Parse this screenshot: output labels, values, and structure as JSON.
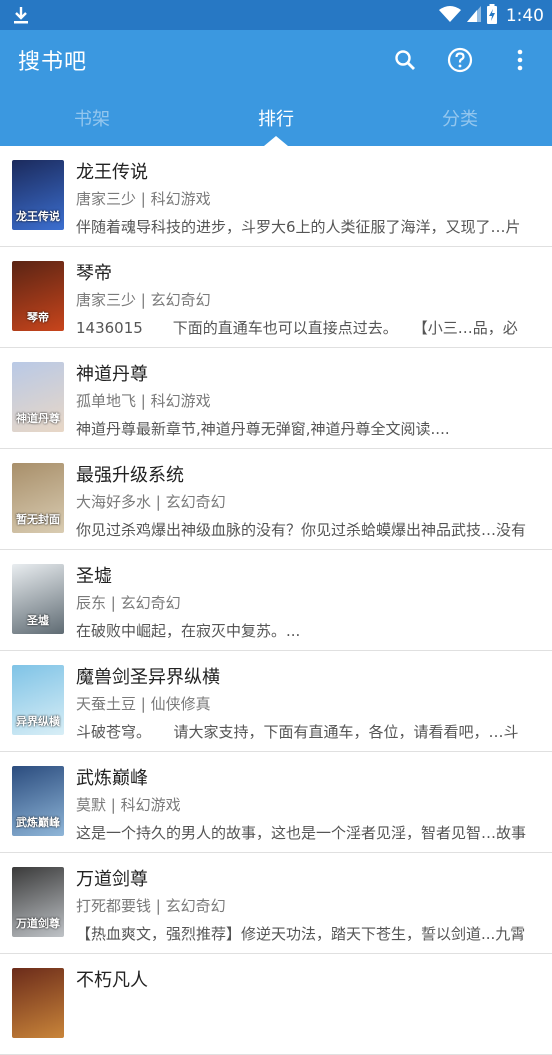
{
  "status_bar": {
    "time": "1:40",
    "download_icon": "download-icon",
    "wifi_icon": "wifi-icon",
    "signal_icon": "signal-icon",
    "battery_icon": "battery-charging-icon"
  },
  "app_bar": {
    "title": "搜书吧",
    "search_icon": "search-icon",
    "help_icon": "help-circle-icon",
    "more_icon": "more-vert-icon"
  },
  "tabs": [
    {
      "label": "书架",
      "active": false
    },
    {
      "label": "排行",
      "active": true
    },
    {
      "label": "分类",
      "active": false
    }
  ],
  "books": [
    {
      "title": "龙王传说",
      "meta": "唐家三少 | 科幻游戏",
      "desc": "伴随着魂导科技的进步，斗罗大6上的人类征服了海洋，又现了…片",
      "cover_colors": [
        "#1b2a5c",
        "#3c6fd0"
      ],
      "cover_text": "龙王传说"
    },
    {
      "title": "琴帝",
      "meta": "唐家三少 | 玄幻奇幻",
      "desc": "1436015　　下面的直通车也可以直接点过去。　　【小三…品，必",
      "cover_colors": [
        "#5a2414",
        "#c8451c"
      ],
      "cover_text": "琴帝"
    },
    {
      "title": "神道丹尊",
      "meta": "孤单地飞 | 科幻游戏",
      "desc": "神道丹尊最新章节,神道丹尊无弹窗,神道丹尊全文阅读....",
      "cover_colors": [
        "#b9c9e6",
        "#e8d7c6"
      ],
      "cover_text": "神道丹尊"
    },
    {
      "title": "最强升级系统",
      "meta": "大海好多水 | 玄幻奇幻",
      "desc": "你见过杀鸡爆出神级血脉的没有？你见过杀蛤蟆爆出神品武技…没有",
      "cover_colors": [
        "#a88f6a",
        "#d9ccb2"
      ],
      "cover_text": "暂无封面"
    },
    {
      "title": "圣墟",
      "meta": "辰东 | 玄幻奇幻",
      "desc": "在破败中崛起，在寂灭中复苏。...",
      "cover_colors": [
        "#e9edf0",
        "#5f6b73"
      ],
      "cover_text": "圣墟"
    },
    {
      "title": "魔兽剑圣异界纵横",
      "meta": "天蚕土豆 | 仙侠修真",
      "desc": "斗破苍穹。　　请大家支持，下面有直通车，各位，请看看吧，…斗",
      "cover_colors": [
        "#7fc3e6",
        "#d8eef6"
      ],
      "cover_text": "异界纵横"
    },
    {
      "title": "武炼巅峰",
      "meta": "莫默 | 科幻游戏",
      "desc": "这是一个持久的男人的故事，这也是一个淫者见淫，智者见智…故事",
      "cover_colors": [
        "#2b4c7e",
        "#8fb6d8"
      ],
      "cover_text": "武炼巅峰"
    },
    {
      "title": "万道剑尊",
      "meta": "打死都要钱 | 玄幻奇幻",
      "desc": "【热血爽文，强烈推荐】修逆天功法，踏天下苍生，誓以剑道...九霄",
      "cover_colors": [
        "#3a3a3a",
        "#bfc3c7"
      ],
      "cover_text": "万道剑尊"
    },
    {
      "title": "不朽凡人",
      "meta": "",
      "desc": "",
      "cover_colors": [
        "#6b2b1a",
        "#c9853a"
      ],
      "cover_text": ""
    }
  ]
}
